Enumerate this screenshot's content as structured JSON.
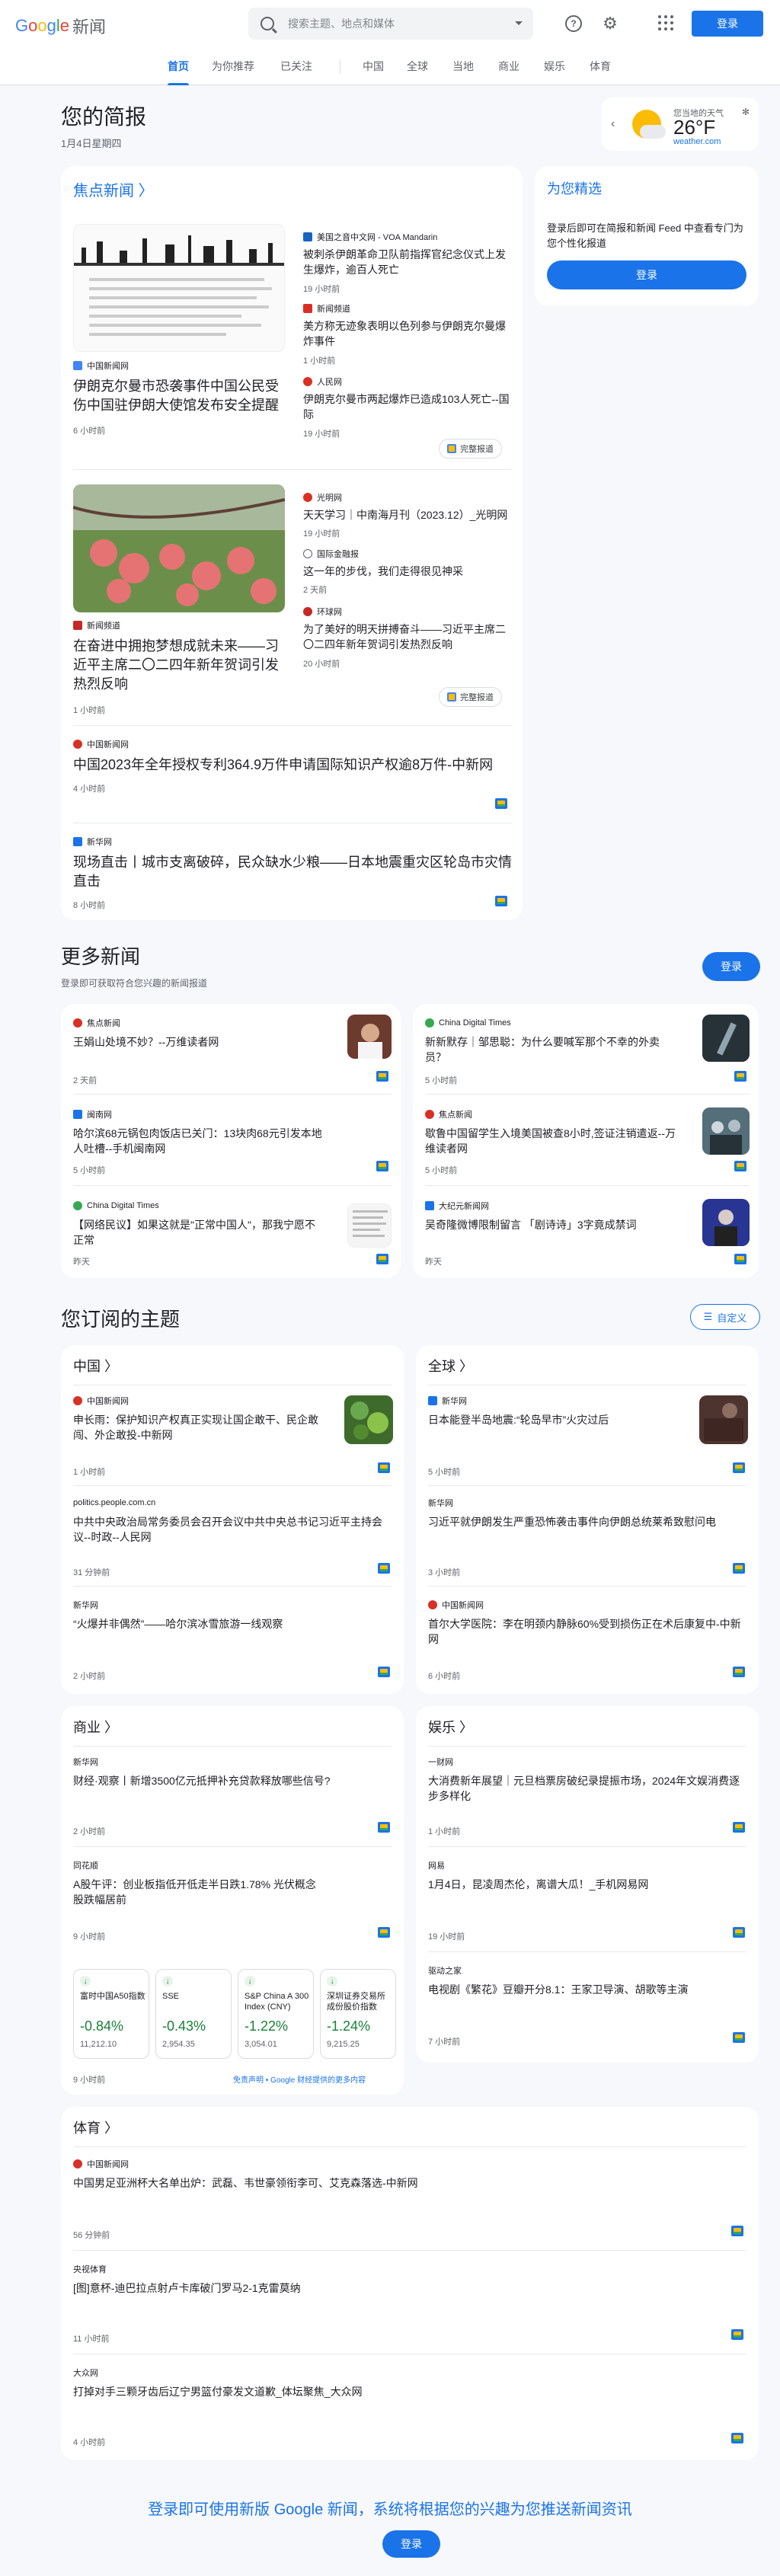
{
  "app": {
    "logo": "Google",
    "logo_suffix": "新闻",
    "search_placeholder": "搜索主题、地点和媒体",
    "signin": "登录"
  },
  "nav": [
    "首页",
    "为你推荐",
    "已关注",
    "中国",
    "全球",
    "当地",
    "商业",
    "娱乐",
    "体育"
  ],
  "briefing": {
    "title": "您的简报",
    "date": "1月4日星期四"
  },
  "weather": {
    "location": "您当地的天气",
    "temp": "26°F",
    "source": "weather.com"
  },
  "top": {
    "title": "焦点新闻 〉",
    "s1": {
      "source": "中国新闻网",
      "title": "伊朗克尔曼市恐袭事件中国公民受伤中国驻伊朗大使馆发布安全提醒",
      "time": "6 小时前"
    },
    "s1r": [
      {
        "source": "美国之音中文网 - VOA Mandarin",
        "title": "被刺杀伊朗革命卫队前指挥官纪念仪式上发生爆炸，逾百人死亡",
        "time": "19 小时前"
      },
      {
        "source": "新闻频道",
        "title": "美方称无迹象表明以色列参与伊朗克尔曼爆炸事件",
        "time": "1 小时前"
      },
      {
        "source": "人民网",
        "title": "伊朗克尔曼市两起爆炸已造成103人死亡--国际",
        "time": "19 小时前"
      }
    ],
    "s2": {
      "source": "新闻频道",
      "title": "在奋进中拥抱梦想成就未来——习近平主席二〇二四年新年贺词引发热烈反响",
      "time": "1 小时前"
    },
    "s2r": [
      {
        "source": "光明网",
        "title": "天天学习｜中南海月刊（2023.12）_光明网",
        "time": "19 小时前"
      },
      {
        "source": "国际金融报",
        "title": "这一年的步伐，我们走得很见神采",
        "time": "2 天前"
      },
      {
        "source": "环球网",
        "title": "为了美好的明天拼搏奋斗——习近平主席二〇二四年新年贺词引发热烈反响",
        "time": "20 小时前"
      }
    ],
    "s3": {
      "source": "中国新闻网",
      "title": "中国2023年全年授权专利364.9万件申请国际知识产权逾8万件-中新网",
      "time": "4 小时前"
    },
    "s4": {
      "source": "新华网",
      "title": "现场直击丨城市支离破碎，民众缺水少粮——日本地震重灾区轮岛市灾情直击",
      "time": "8 小时前"
    },
    "fullcov": "完整报道"
  },
  "picks": {
    "title": "为您精选",
    "text": "登录后即可在简报和新闻 Feed 中查看专门为您个性化报道",
    "btn": "登录"
  },
  "more": {
    "title": "更多新闻",
    "sub": "登录即可获取符合您兴趣的新闻报道",
    "btn": "登录",
    "items": [
      {
        "source": "焦点新闻",
        "title": "王娟山处境不妙？--万维读者网",
        "time": "2 天前"
      },
      {
        "source": "China Digital Times",
        "title": "新新默存｜邹思聪：为什么要喊军那个不幸的外卖员？",
        "time": "5 小时前"
      },
      {
        "source": "闽南网",
        "title": "哈尔滨68元锅包肉饭店已关门：13块肉68元引发本地人吐槽--手机闽南网",
        "time": "5 小时前"
      },
      {
        "source": "焦点新闻",
        "title": "歇鲁中国留学生入境美国被查8小时,签证注销遣返--万维读者网",
        "time": "5 小时前"
      },
      {
        "source": "China Digital Times",
        "title": "【网络民议】如果这就是\"正常中国人\"，那我宁愿不正常",
        "time": "昨天"
      },
      {
        "source": "大纪元新闻网",
        "title": "吴奇隆微博限制留言 「剧诗诗」3字竟成禁词",
        "time": "昨天"
      }
    ]
  },
  "topics": {
    "title": "您订阅的主题",
    "customize": "自定义",
    "china": {
      "title": "中国 〉",
      "items": [
        {
          "source": "中国新闻网",
          "title": "申长雨：保护知识产权真正实现让国企敢干、民企敢闯、外企敢投-中新网",
          "time": "1 小时前"
        },
        {
          "source": "politics.people.com.cn",
          "title": "中共中央政治局常务委员会召开会议中共中央总书记习近平主持会议--时政--人民网",
          "time": "31 分钟前"
        },
        {
          "source": "新华网",
          "title": "“火爆并非偶然”——哈尔滨冰雪旅游一线观察",
          "time": "2 小时前"
        }
      ]
    },
    "world": {
      "title": "全球 〉",
      "items": [
        {
          "source": "新华网",
          "title": "日本能登半岛地震:“轮岛早市”火灾过后",
          "time": "5 小时前"
        },
        {
          "source": "新华网",
          "title": "习近平就伊朗发生严重恐怖袭击事件向伊朗总统莱希致慰问电",
          "time": "3 小时前"
        },
        {
          "source": "中国新闻网",
          "title": "首尔大学医院：李在明颈内静脉60%受到损伤正在术后康复中-中新网",
          "time": "6 小时前"
        }
      ]
    },
    "business": {
      "title": "商业 〉",
      "items": [
        {
          "source": "新华网",
          "title": "财经·观察丨新增3500亿元抵押补充贷款释放哪些信号?",
          "time": "2 小时前"
        },
        {
          "source": "同花顺",
          "title": "A股午评：创业板指低开低走半日跌1.78% 光伏概念股跌幅居前",
          "time": "9 小时前"
        }
      ],
      "stocks": [
        {
          "name": "富时中国A50指数",
          "pct": "-0.84%",
          "val": "11,212.10"
        },
        {
          "name": "SSE",
          "pct": "-0.43%",
          "val": "2,954.35"
        },
        {
          "name": "S&P China A 300 Index (CNY)",
          "pct": "-1.22%",
          "val": "3,054.01"
        },
        {
          "name": "深圳证券交易所成份股价指数",
          "pct": "-1.24%",
          "val": "9,215.25"
        }
      ],
      "disclaimer": "免责声明 • Google 财经提供的更多内容"
    },
    "ent": {
      "title": "娱乐 〉",
      "items": [
        {
          "source": "一财网",
          "title": "大消费新年展望｜元旦档票房破纪录提振市场，2024年文娱消费逐步多样化",
          "time": "1 小时前"
        },
        {
          "source": "网易",
          "title": "1月4日，昆凌周杰伦，离谱大瓜！_手机网易网",
          "time": "19 小时前"
        },
        {
          "source": "驱动之家",
          "title": "电视剧《繁花》豆瓣开分8.1：王家卫导演、胡歌等主演",
          "time": "7 小时前"
        }
      ]
    },
    "sports": {
      "title": "体育 〉",
      "items": [
        {
          "source": "中国新闻网",
          "title": "中国男足亚洲杯大名单出炉：武磊、韦世豪领衔李可、艾克森落选-中新网",
          "time": "56 分钟前"
        },
        {
          "source": "央视体育",
          "title": "[图]意杯-迪巴拉点射卢卡库破门罗马2-1克雷莫纳",
          "time": "11 小时前"
        },
        {
          "source": "大众网",
          "title": "打掉对手三颗牙齿后辽宁男篮付豪发文道歉_体坛聚焦_大众网",
          "time": "4 小时前"
        }
      ]
    }
  },
  "footer": {
    "text": "登录即可使用新版 Google 新闻，系统将根据您的兴趣为您推送新闻资讯",
    "btn": "登录"
  }
}
